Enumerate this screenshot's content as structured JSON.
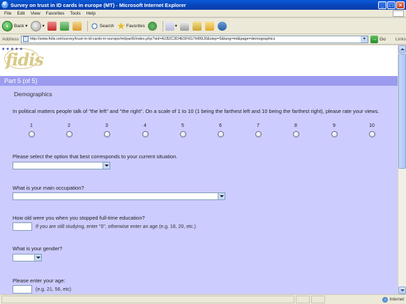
{
  "window": {
    "title": "Survey on trust in ID cards in europe (MT) - Microsoft Internet Explorer"
  },
  "menu": [
    "File",
    "Edit",
    "View",
    "Favorites",
    "Tools",
    "Help"
  ],
  "toolbar": {
    "back_label": "Back",
    "search_label": "Search",
    "favorites_label": "Favorites"
  },
  "address": {
    "label": "Address",
    "url": "http://www.fidis.net/survey/trust-in-id-cards-in-europe/mt/part5/index.php?sid=A1B2C3D4E5F6G7H8I9J0&step=5&lang=mt&page=demographics",
    "go_label": "Go",
    "links_label": "Links"
  },
  "page": {
    "logo_text": "fidis",
    "part_label": "Part 5 (of 5)",
    "section_title": "Demographics"
  },
  "questions": {
    "political": {
      "text": "In political matters people talk of \"the left\" and \"the right\". On a scale of 1 to 10 (1 being the farthest left and 10 being the farthest right), please rate your views.",
      "scale": [
        "1",
        "2",
        "3",
        "4",
        "5",
        "6",
        "7",
        "8",
        "9",
        "10"
      ]
    },
    "situation": {
      "text": "Please select the option that best corresponds to your current situation."
    },
    "occupation": {
      "text": "What is your main occupation?"
    },
    "education": {
      "text": "How old were you when you stopped full-time education?",
      "hint": "If you are still studying, enter \"0\", otherwise enter an age (e.g. 18, 20, etc.)"
    },
    "gender": {
      "text": "What is your gender?"
    },
    "age": {
      "text": "Please enter your age:",
      "hint": "(e.g. 21, 56, etc)"
    }
  },
  "status": {
    "zone": "Internet"
  }
}
